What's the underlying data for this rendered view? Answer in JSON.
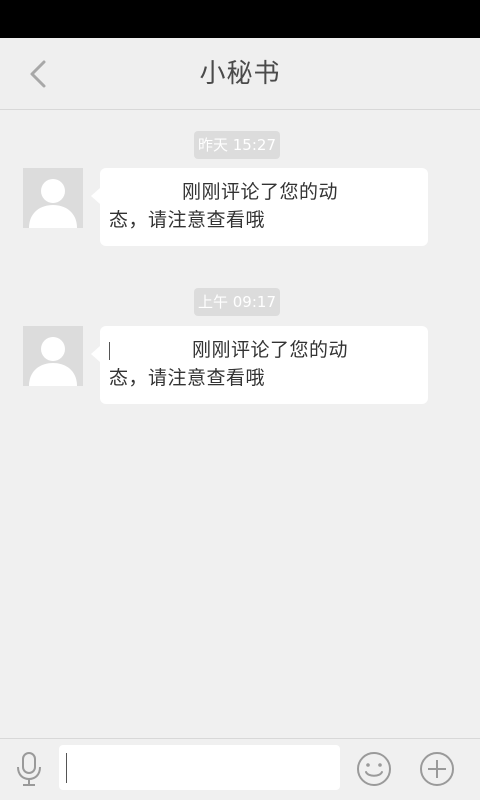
{
  "header": {
    "title": "小秘书"
  },
  "messages": [
    {
      "timestamp": "昨天 15:27",
      "text_line1": "刚刚评论了您的动",
      "text_line2": "态，请注意查看哦"
    },
    {
      "timestamp": "上午 09:17",
      "text_line1": "刚刚评论了您的动",
      "text_line2": "态，请注意查看哦"
    }
  ],
  "input": {
    "value": ""
  },
  "icons": {
    "back": "back-arrow-icon",
    "avatar": "default-avatar-icon",
    "mic": "microphone-icon",
    "emoji": "emoji-icon",
    "plus": "plus-icon"
  }
}
